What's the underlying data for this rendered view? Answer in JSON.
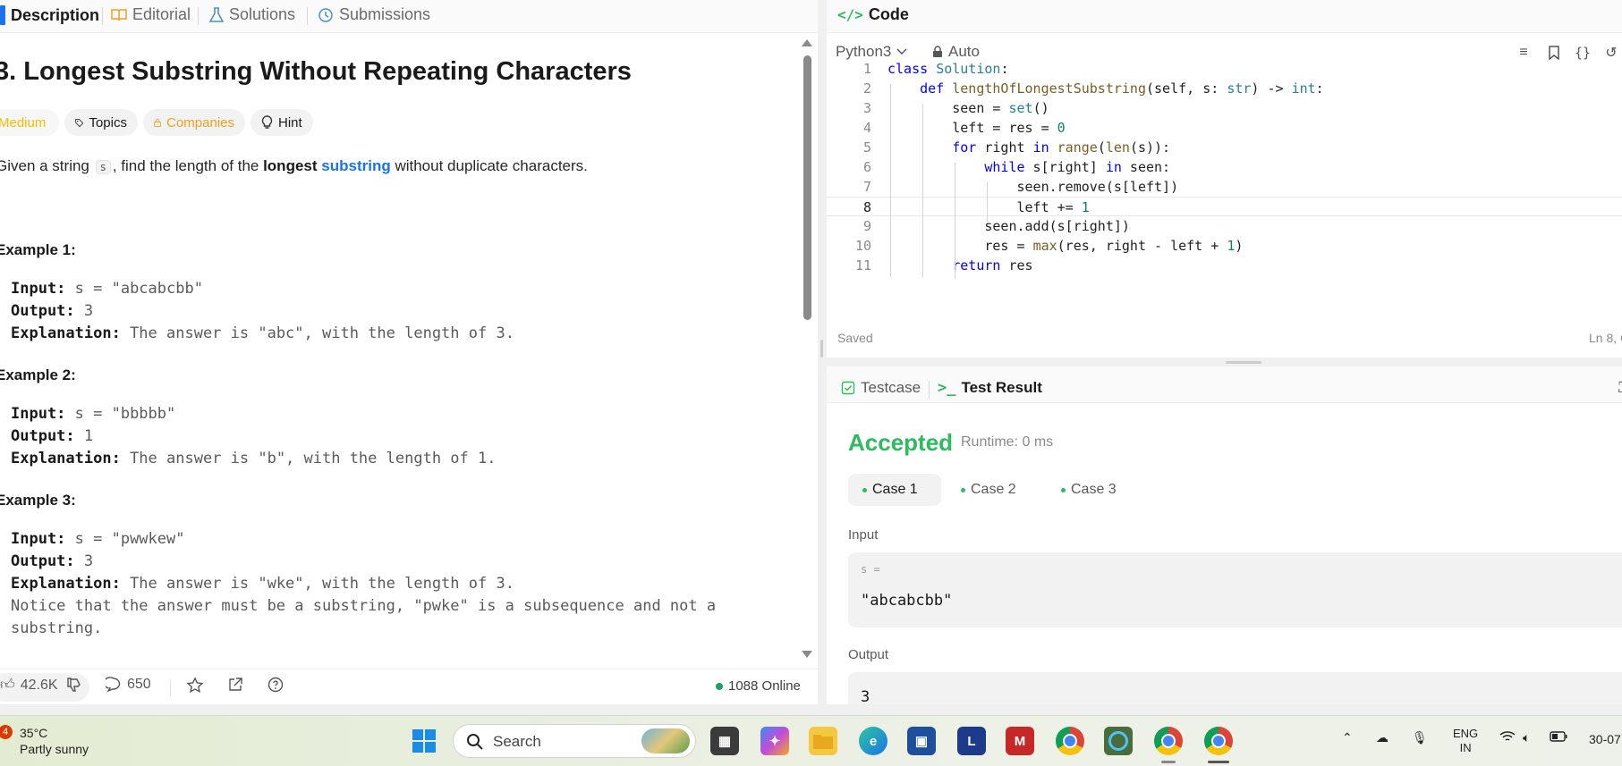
{
  "left_panel": {
    "tabs": [
      {
        "label": "Description",
        "icon": "description-icon"
      },
      {
        "label": "Editorial",
        "icon": "book-icon"
      },
      {
        "label": "Solutions",
        "icon": "flask-icon"
      },
      {
        "label": "Submissions",
        "icon": "history-icon"
      }
    ],
    "title": "3. Longest Substring Without Repeating Characters",
    "difficulty": "Medium",
    "chips": {
      "topics": "Topics",
      "companies": "Companies",
      "hint": "Hint"
    },
    "description": {
      "prefix": "Given a string ",
      "code": "s",
      "middle": ", find the length of the ",
      "bold": "longest",
      "link": "substring",
      "suffix": " without duplicate characters."
    },
    "examples": [
      {
        "title": "Example 1:",
        "input_label": "Input:",
        "input": " s = \"abcabcbb\"",
        "output_label": "Output:",
        "output": " 3",
        "explanation_label": "Explanation:",
        "explanation": " The answer is \"abc\", with the length of 3."
      },
      {
        "title": "Example 2:",
        "input_label": "Input:",
        "input": " s = \"bbbbb\"",
        "output_label": "Output:",
        "output": " 1",
        "explanation_label": "Explanation:",
        "explanation": " The answer is \"b\", with the length of 1."
      },
      {
        "title": "Example 3:",
        "input_label": "Input:",
        "input": " s = \"pwwkew\"",
        "output_label": "Output:",
        "output": " 3",
        "explanation_label": "Explanation:",
        "explanation": " The answer is \"wke\", with the length of 3.",
        "note_line1": "Notice that the answer must be a substring, \"pwke\" is a subsequence and not a",
        "note_line2": "substring."
      }
    ],
    "footer": {
      "likes": "42.6K",
      "comments": "650",
      "online": "1088 Online"
    }
  },
  "code_panel": {
    "title": "Code",
    "language": "Python3",
    "mode": "Auto",
    "status": "Saved",
    "cursor": "Ln 8, C"
  },
  "result_panel": {
    "tabs": {
      "testcase": "Testcase",
      "test_result": "Test Result"
    },
    "status": "Accepted",
    "runtime": "Runtime: 0 ms",
    "cases": [
      "Case 1",
      "Case 2",
      "Case 3"
    ],
    "input_label": "Input",
    "input_var": "s =",
    "input_value": "\"abcabcbb\"",
    "output_label": "Output",
    "output_value": "3"
  },
  "taskbar": {
    "weather_badge": "4",
    "temperature": "35°C",
    "weather": "Partly sunny",
    "search_placeholder": "Search",
    "lang_line1": "ENG",
    "lang_line2": "IN",
    "date": "30-07"
  },
  "colors": {
    "accepted": "#2cbb5d",
    "medium": "#ffb800",
    "link": "#1a73e8"
  }
}
